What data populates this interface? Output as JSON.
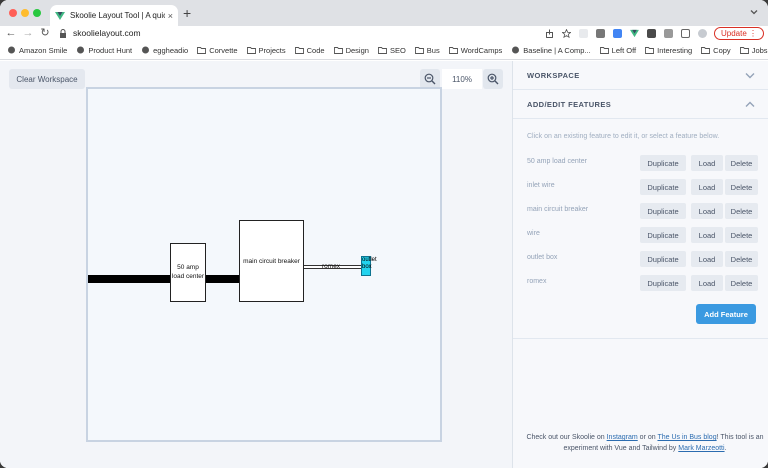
{
  "browser": {
    "tab_title": "Skoolie Layout Tool | A quick to",
    "url": "skoolielayout.com",
    "update_label": "Update",
    "bookmarks": [
      "Amazon Smile",
      "Product Hunt",
      "eggheadio",
      "Corvette",
      "Projects",
      "Code",
      "Design",
      "SEO",
      "Bus",
      "WordCamps",
      "Baseline | A Comp...",
      "Left Off",
      "Interesting",
      "Copy",
      "Jobs"
    ]
  },
  "toolbar": {
    "clear_label": "Clear Workspace",
    "zoom": "110%"
  },
  "canvas": {
    "load_center_label": "50 amp load center",
    "breaker_label": "main circuit breaker",
    "romex_label": "romex",
    "outlet_label": "outlet box"
  },
  "sidebar": {
    "workspace_header": "WORKSPACE",
    "features_header": "ADD/EDIT FEATURES",
    "hint": "Click on an existing feature to edit it, or select a feature below.",
    "duplicate_label": "Duplicate",
    "load_label": "Load",
    "delete_label": "Delete",
    "features": [
      {
        "name": "50 amp load center"
      },
      {
        "name": "inlet wire"
      },
      {
        "name": "main circuit breaker"
      },
      {
        "name": "wire"
      },
      {
        "name": "outlet box"
      },
      {
        "name": "romex"
      }
    ],
    "add_label": "Add Feature"
  },
  "footer": {
    "t1": "Check out our Skoolie on ",
    "instagram": "Instagram",
    "t2": " or on ",
    "blog": "The Us in Bus blog",
    "t3": "! This tool is an experiment with Vue and Tailwind by ",
    "author": "Mark Marzeotti",
    "t4": "."
  },
  "colors": {
    "accent": "#3b9ae1",
    "outlet": "#22d3ee",
    "update": "#d93025"
  }
}
